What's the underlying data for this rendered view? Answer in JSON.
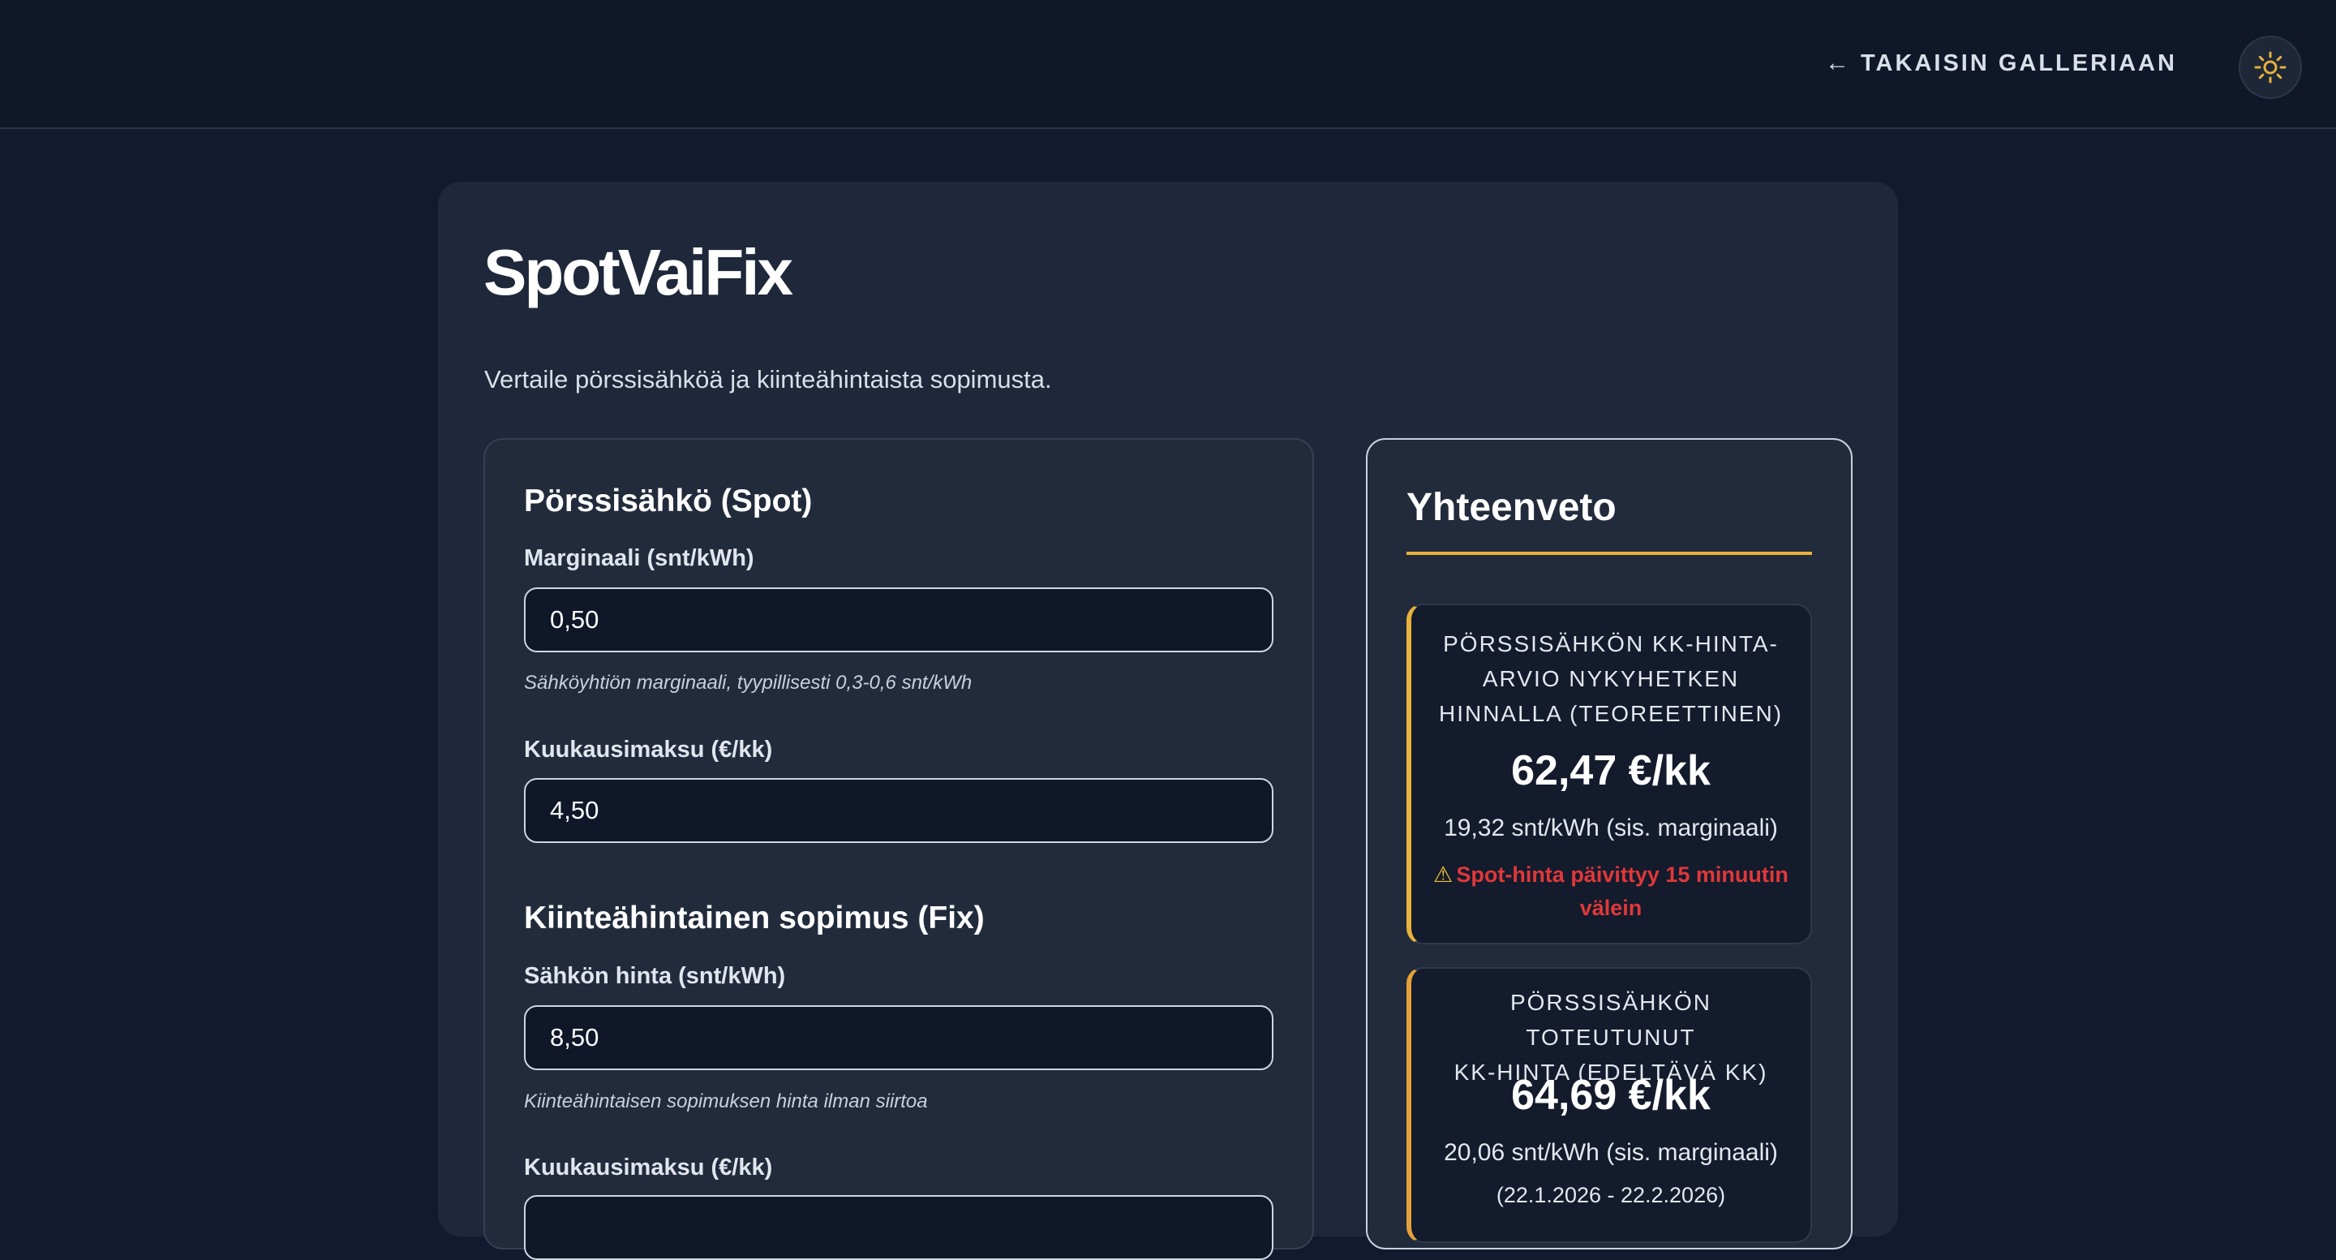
{
  "header": {
    "back_arrow": "←",
    "back_label": "TAKAISIN GALLERIAAN",
    "theme_icon": "sun-icon",
    "accent": "#e6b23a"
  },
  "page": {
    "title": "SpotVaiFix",
    "subtitle": "Vertaile pörssisähköä ja kiinteähintaista sopimusta."
  },
  "spot": {
    "title": "Pörssisähkö (Spot)",
    "margin_label": "Marginaali (snt/kWh)",
    "margin_value": "0,50",
    "margin_hint": "Sähköyhtiön marginaali, tyypillisesti 0,3-0,6 snt/kWh",
    "fee_label": "Kuukausimaksu (€/kk)",
    "fee_value": "4,50"
  },
  "fix": {
    "title": "Kiinteähintainen sopimus (Fix)",
    "price_label": "Sähkön hinta (snt/kWh)",
    "price_value": "8,50",
    "price_hint": "Kiinteähintaisen sopimuksen hinta ilman siirtoa",
    "fee_label": "Kuukausimaksu (€/kk)",
    "fee_value": ""
  },
  "summary": {
    "title": "Yhteenveto",
    "current": {
      "heading_line1": "PÖRSSISÄHKÖN KK-HINTA-",
      "heading_line2": "ARVIO NYKYHETKEN",
      "heading_line3": "HINNALLA (TEOREETTINEN)",
      "value": "62,47 €/kk",
      "sub": "19,32 snt/kWh (sis. marginaali)",
      "warning_icon": "⚠",
      "warning_line1": "Spot-hinta päivittyy 15 minuutin",
      "warning_line2": "välein"
    },
    "previous": {
      "heading_line1": "PÖRSSISÄHKÖN TOTEUTUNUT",
      "heading_line2": "KK-HINTA (EDELTÄVÄ KK)",
      "value": "64,69 €/kk",
      "sub": "20,06 snt/kWh (sis. marginaali)",
      "dates": "(22.1.2026 - 22.2.2026)"
    }
  }
}
